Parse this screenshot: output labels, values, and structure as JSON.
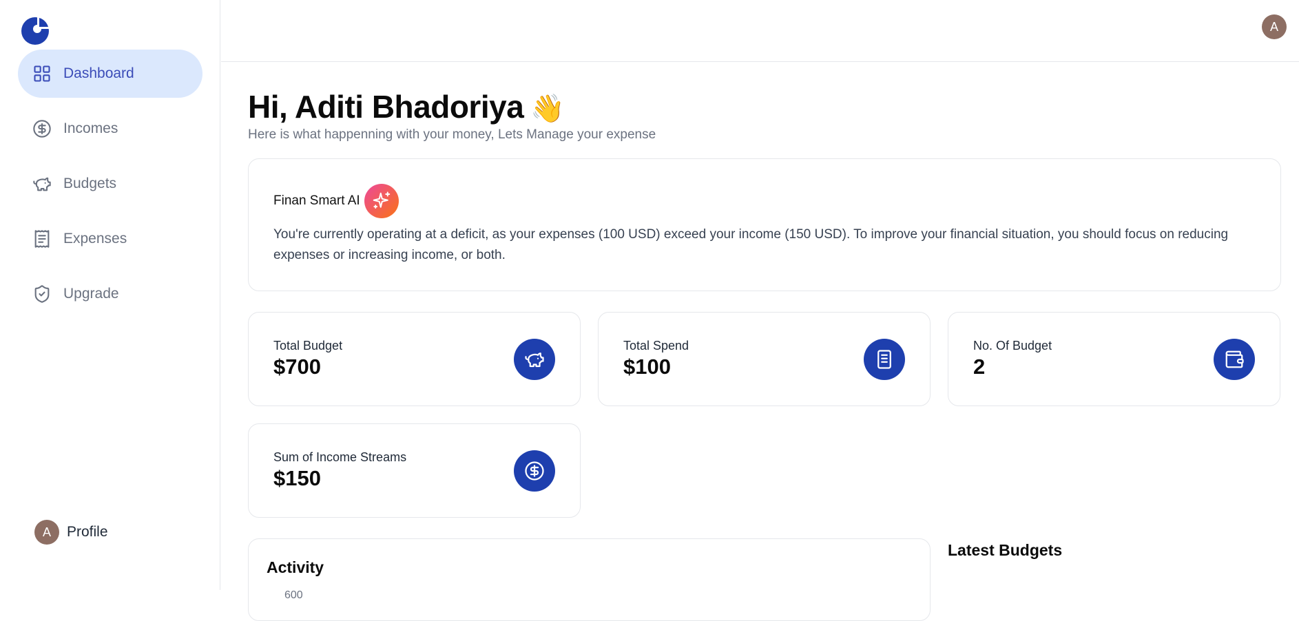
{
  "sidebar": {
    "logo_icon": "pie-chart-logo-icon",
    "items": [
      {
        "label": "Dashboard",
        "icon": "layout-grid-icon",
        "active": true
      },
      {
        "label": "Incomes",
        "icon": "circle-dollar-icon",
        "active": false
      },
      {
        "label": "Budgets",
        "icon": "piggy-bank-icon",
        "active": false
      },
      {
        "label": "Expenses",
        "icon": "receipt-icon",
        "active": false
      },
      {
        "label": "Upgrade",
        "icon": "shield-check-icon",
        "active": false
      }
    ],
    "profile": {
      "avatar_letter": "A",
      "label": "Profile"
    }
  },
  "header": {
    "avatar_letter": "A"
  },
  "main": {
    "greeting": "Hi, Aditi Bhadoriya",
    "greeting_emoji": "👋",
    "subtitle": "Here is what happenning with your money, Lets Manage your expense",
    "ai": {
      "title": "Finan Smart AI",
      "icon": "sparkles-icon",
      "message": "You're currently operating at a deficit, as your expenses (100 USD) exceed your income (150 USD). To improve your financial situation, you should focus on reducing expenses or increasing income, or both."
    },
    "stats": [
      {
        "label": "Total Budget",
        "value": "$700",
        "icon": "piggy-bank-icon"
      },
      {
        "label": "Total Spend",
        "value": "$100",
        "icon": "receipt-icon"
      },
      {
        "label": "No. Of Budget",
        "value": "2",
        "icon": "wallet-icon"
      },
      {
        "label": "Sum of Income Streams",
        "value": "$150",
        "icon": "circle-dollar-icon"
      }
    ],
    "activity": {
      "title": "Activity",
      "first_tick": "600"
    },
    "latest_budgets_title": "Latest Budgets"
  },
  "colors": {
    "accent": "#1e3fae",
    "active_bg": "#dbe8fd",
    "active_text": "#3b4cb8",
    "avatar": "#8d6e63"
  }
}
